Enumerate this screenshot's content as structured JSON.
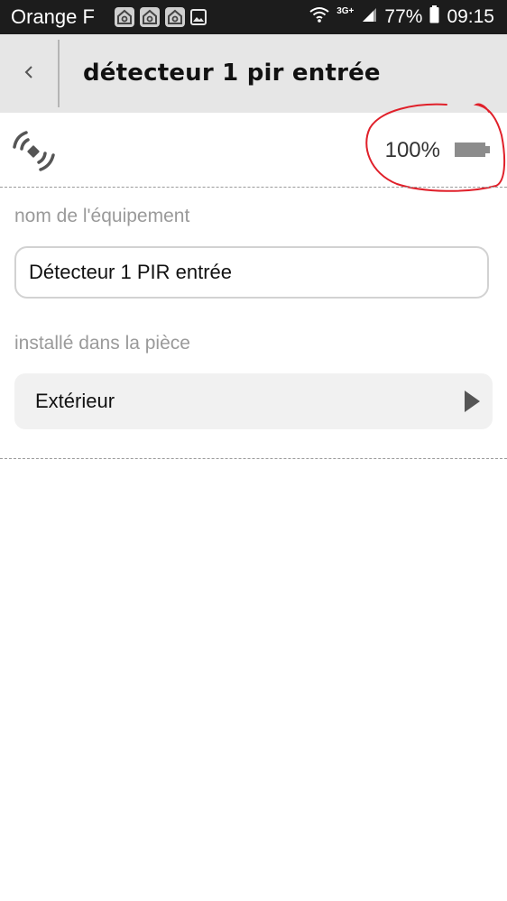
{
  "status_bar": {
    "carrier": "Orange F",
    "network_type": "3G+",
    "battery_percent": "77%",
    "time": "09:15",
    "notification_icons": [
      "home-app-icon",
      "home-app-icon",
      "home-app-icon",
      "image-icon"
    ]
  },
  "header": {
    "back_icon": "chevron-left-icon",
    "title": "détecteur 1 pir entrée"
  },
  "device": {
    "signal_icon": "wireless-signal-icon",
    "battery_level": "100%",
    "battery_icon": "battery-icon"
  },
  "form": {
    "name_label": "nom de l'équipement",
    "name_value": "Détecteur 1 PIR entrée",
    "room_label": "installé dans la pièce",
    "room_value": "Extérieur"
  },
  "colors": {
    "annotation": "#e0202a",
    "header_bg": "#e6e6e6",
    "label_gray": "#9a9a9a",
    "select_bg": "#f1f1f1"
  }
}
